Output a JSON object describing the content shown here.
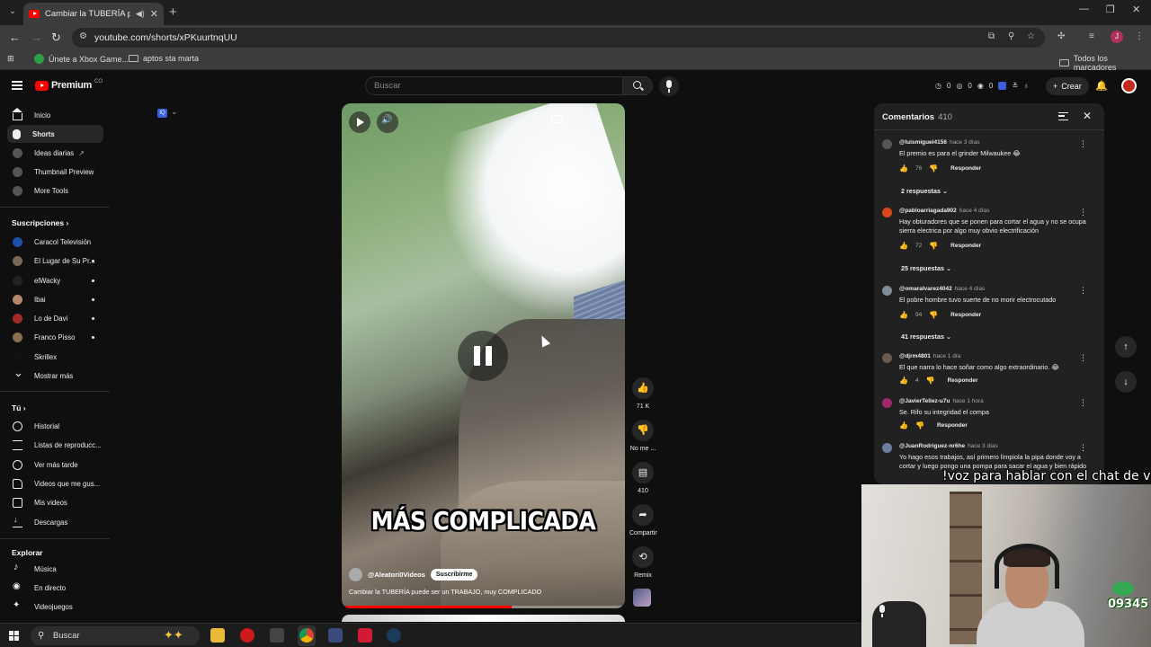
{
  "browser": {
    "tab_title": "Cambiar la TUBERÍA puede",
    "url": "youtube.com/shorts/xPKuurtnqUU",
    "bookmarks": [
      "Únete a Xbox Game...",
      "aptos sta marta"
    ],
    "all_bookmarks": "Todos los marcadores",
    "profile_initial": "J"
  },
  "youtube": {
    "logo_text": "Premium",
    "logo_country": "CO",
    "search_placeholder": "Buscar",
    "header_stats": [
      "0",
      "0",
      "0"
    ],
    "create_label": "Crear"
  },
  "sidebar": {
    "main": [
      {
        "label": "Inicio"
      },
      {
        "label": "Shorts"
      },
      {
        "label": "Ideas diarias"
      },
      {
        "label": "Thumbnail Preview"
      },
      {
        "label": "More Tools"
      }
    ],
    "subscriptions_title": "Suscripciones",
    "subscriptions": [
      {
        "label": "Caracol Televisión",
        "color": "#1d4fa8"
      },
      {
        "label": "El Lugar de Su Pr...",
        "color": "#7a6a55"
      },
      {
        "label": "elWacky",
        "color": "#222222"
      },
      {
        "label": "Ibai",
        "color": "#b5876a"
      },
      {
        "label": "Lo de Davi",
        "color": "#a42a2a"
      },
      {
        "label": "Franco Pisso",
        "color": "#8b6f4f"
      },
      {
        "label": "Skrillex",
        "color": "#111111"
      }
    ],
    "show_more": "Mostrar más",
    "you_title": "Tú",
    "you": [
      {
        "label": "Historial"
      },
      {
        "label": "Listas de reproducc..."
      },
      {
        "label": "Ver más tarde"
      },
      {
        "label": "Videos que me gus..."
      },
      {
        "label": "Mis videos"
      },
      {
        "label": "Descargas"
      }
    ],
    "explore_title": "Explorar",
    "explore": [
      {
        "label": "Música"
      },
      {
        "label": "En directo"
      },
      {
        "label": "Videojuegos"
      }
    ]
  },
  "video": {
    "caption": "MÁS COMPLICADA",
    "channel": "@Aleatori0Videos",
    "subscribe": "Suscribirme",
    "title": "Cambiar la TUBERÍA puede ser un TRABAJO, muy COMPLICADO",
    "progress": 0.6
  },
  "actions": {
    "likes": "71 K",
    "dislike": "No me ...",
    "comments": "410",
    "share": "Compartir",
    "remix": "Remix"
  },
  "comments_panel": {
    "title": "Comentarios",
    "count": "410",
    "reply_label": "Responder",
    "items": [
      {
        "user": "@luismiguel4156",
        "time": "hace 3 días",
        "text": "El premio es para el grinder  Milwaukee 😂",
        "likes": "76",
        "replies": "2 respuestas",
        "color": "#555555"
      },
      {
        "user": "@pabloarriagada902",
        "time": "hace 4 días",
        "text": "Hay obturadores que se ponen para cortar el agua y no se ocupa sierra electrica por algo muy obvio electrificación",
        "likes": "72",
        "replies": "25 respuestas",
        "color": "#d9481c"
      },
      {
        "user": "@omaralvarez4042",
        "time": "hace 4 días",
        "text": "El pobre hombre tuvo suerte de no morir electrocutado",
        "likes": "94",
        "replies": "41 respuestas",
        "color": "#7f8c99"
      },
      {
        "user": "@djrm4801",
        "time": "hace 1 día",
        "text": "El que narra lo hace soñar como algo extraordinario. 😂",
        "likes": "4",
        "replies": "",
        "color": "#6a5a4e"
      },
      {
        "user": "@JavierTellez-u7u",
        "time": "hace 1 hora",
        "text": "Se. Rifo su integridad el compa",
        "likes": "",
        "replies": "",
        "color": "#9c2a6b"
      },
      {
        "user": "@JuanRodriguez-nr6he",
        "time": "hace 3 días",
        "text": "Yo hago esos trabajos, así primero límpiola la pipa donde voy a cortar y luego pongo una pompa para sacar el agua y bien rápido",
        "likes": "",
        "replies": "",
        "color": "#6d7fa0"
      }
    ]
  },
  "stream": {
    "overlay_text": "!voz para hablar con el chat de voz",
    "badge": "09345"
  },
  "taskbar": {
    "search_label": "Buscar"
  }
}
